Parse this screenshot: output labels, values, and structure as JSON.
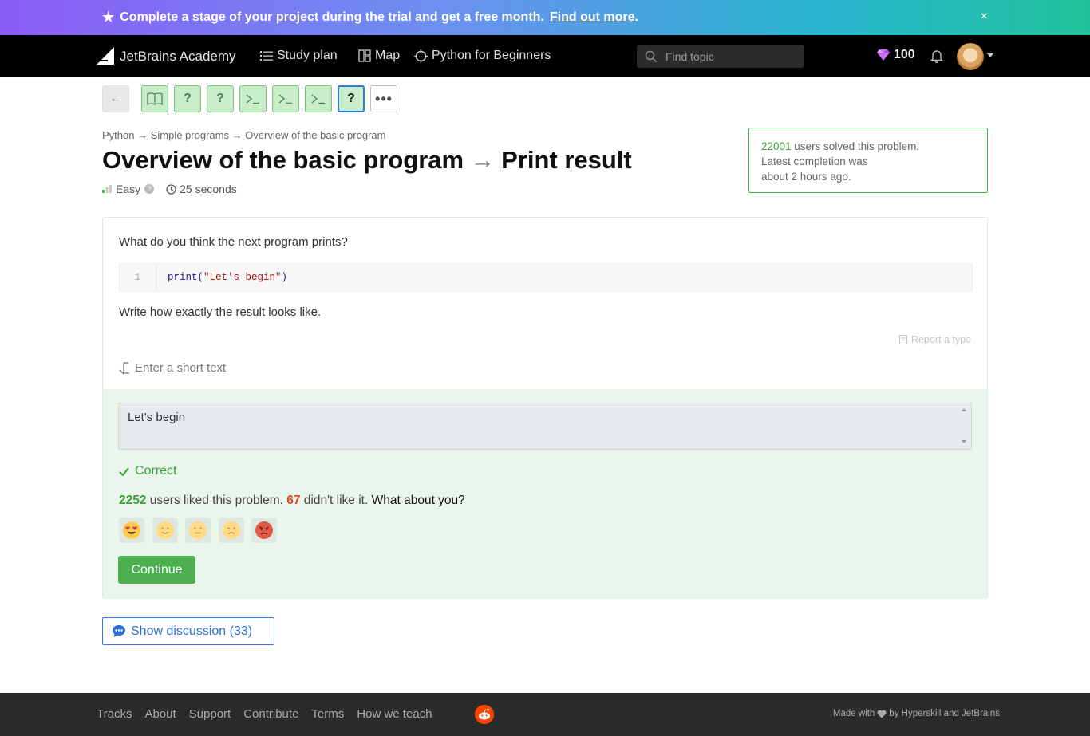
{
  "banner": {
    "message": "Complete a stage of your project during the trial and get a free month.",
    "link": "Find out more.",
    "close": "×"
  },
  "nav": {
    "brand": "JetBrains Academy",
    "study_plan": "Study plan",
    "map": "Map",
    "track": "Python for Beginners",
    "search_placeholder": "Find topic",
    "gems": "100"
  },
  "steps": [
    {
      "type": "back",
      "label": "←"
    },
    {
      "type": "theory",
      "icon": "book-icon"
    },
    {
      "type": "quiz",
      "label": "?"
    },
    {
      "type": "quiz",
      "label": "?"
    },
    {
      "type": "code",
      "icon": "terminal-icon"
    },
    {
      "type": "code",
      "icon": "terminal-icon"
    },
    {
      "type": "code",
      "icon": "terminal-icon"
    },
    {
      "type": "quiz",
      "label": "?",
      "current": true
    },
    {
      "type": "more",
      "label": "•••"
    }
  ],
  "breadcrumb": "Python → Simple programs → Overview of the basic program",
  "title": {
    "topic": "Overview of the basic program",
    "arrow": "→",
    "task": "Print result"
  },
  "meta": {
    "difficulty": "Easy",
    "help": "?",
    "time": "25 seconds"
  },
  "stats": {
    "count": "22001",
    "line1": " users solved this problem.",
    "line2": "Latest completion was",
    "line3": "about 2 hours ago."
  },
  "task": {
    "question": "What do you think the next program prints?",
    "code_line_number": "1",
    "code_func": "print(",
    "code_string": "\"Let's begin\"",
    "code_close": ")",
    "instruction": "Write how exactly the result looks like.",
    "report_typo": "Report a typo",
    "answer_label": "Enter a short text",
    "answer_value": "Let's begin",
    "result": "Correct"
  },
  "feedback": {
    "likes": "2252",
    "likes_text": " users liked this problem. ",
    "dislikes": "67",
    "dislikes_text": " didn't like it. ",
    "ask": "What about you?",
    "emojis": [
      "heart-eyes-emoji",
      "smile-emoji",
      "neutral-emoji",
      "frown-emoji",
      "angry-emoji"
    ],
    "continue": "Continue"
  },
  "discussion": "Show discussion (33)",
  "footer": {
    "links": [
      "Tracks",
      "About",
      "Support",
      "Contribute",
      "Terms",
      "How we teach"
    ],
    "credits_prefix": "Made with",
    "credits_suffix": "by Hyperskill and JetBrains"
  },
  "colors": {
    "accent_green": "#4caf50",
    "accent_blue": "#2f7ce0",
    "dislike_red": "#e5491d"
  }
}
